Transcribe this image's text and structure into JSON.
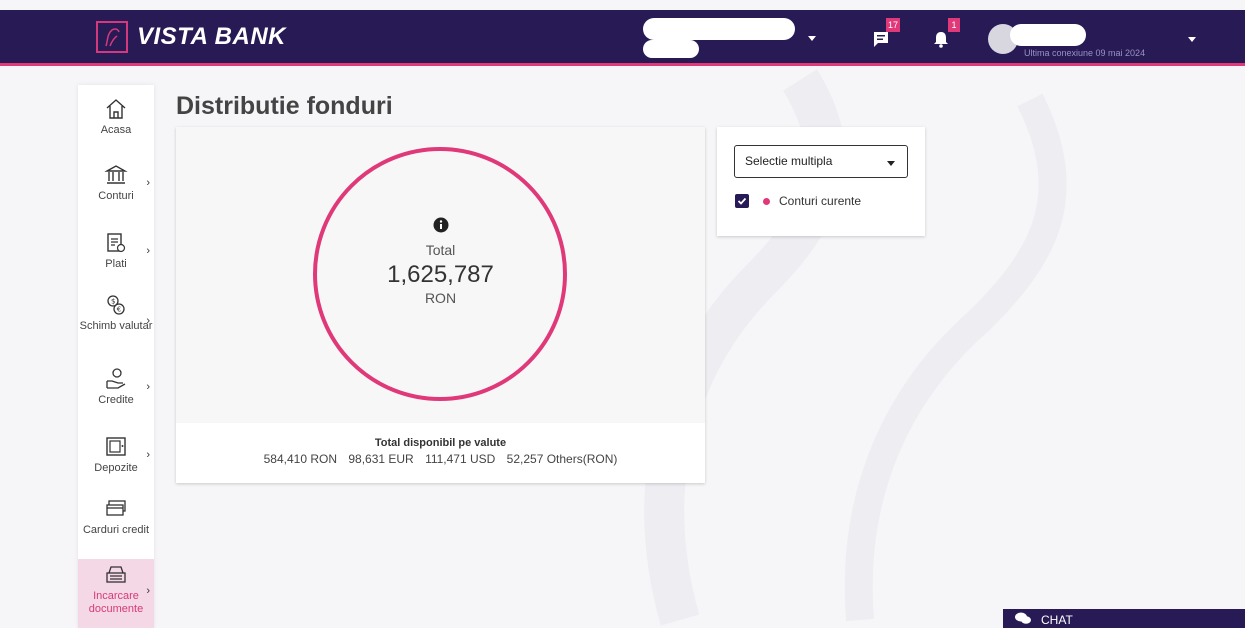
{
  "app": {
    "brand": "VISTA BANK",
    "colors": {
      "primary": "#271a55",
      "accent": "#e0397a"
    }
  },
  "header": {
    "messages_icon": "message-icon",
    "messages_count": "17",
    "notifications_icon": "bell-icon",
    "notifications_count": "1",
    "last_connection": "Ultima conexiune 09 mai 2024"
  },
  "sidebar": {
    "items": [
      {
        "label": "Acasa",
        "icon": "home-icon",
        "has_submenu": false
      },
      {
        "label": "Conturi",
        "icon": "bank-icon",
        "has_submenu": true
      },
      {
        "label": "Plati",
        "icon": "payment-document-icon",
        "has_submenu": true
      },
      {
        "label": "Schimb valutar",
        "icon": "currency-exchange-icon",
        "has_submenu": true
      },
      {
        "label": "Credite",
        "icon": "hand-coin-icon",
        "has_submenu": true
      },
      {
        "label": "Depozite",
        "icon": "safe-icon",
        "has_submenu": true
      },
      {
        "label": "Carduri credit",
        "icon": "credit-card-icon",
        "has_submenu": false
      },
      {
        "label": "Incarcare documente",
        "icon": "document-upload-icon",
        "has_submenu": true,
        "active": true
      }
    ]
  },
  "page": {
    "title": "Distributie fonduri"
  },
  "chart": {
    "info_icon": "info-icon",
    "total_label": "Total",
    "total_value": "1,625,787",
    "total_currency": "RON",
    "footer_title": "Total disponibil pe valute",
    "currency_totals": [
      "584,410 RON",
      "98,631 EUR",
      "111,471 USD",
      "52,257 Others(RON)"
    ]
  },
  "chart_data": {
    "type": "pie",
    "categories": [
      "Conturi curente"
    ],
    "values": [
      1625787
    ],
    "colors": [
      "#e0397a"
    ],
    "center_text": [
      "Total",
      "1,625,787",
      "RON"
    ]
  },
  "filter": {
    "select_value": "Selectie multipla",
    "legend": [
      {
        "label": "Conturi curente",
        "checked": true,
        "color": "#e0397a"
      }
    ]
  },
  "chat": {
    "label": "CHAT"
  }
}
